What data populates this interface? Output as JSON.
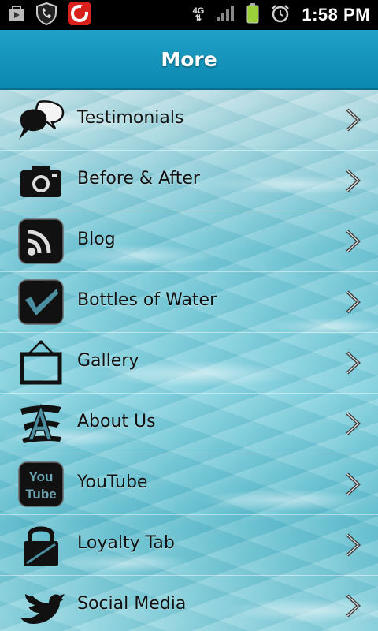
{
  "status_bar": {
    "time": "1:58 PM",
    "network": "4G",
    "icons": [
      "shopping-bag-icon",
      "shield-phone-icon",
      "red-app-icon",
      "signal-icon",
      "battery-icon",
      "alarm-clock-icon"
    ]
  },
  "header": {
    "title": "More"
  },
  "menu": {
    "items": [
      {
        "label": "Testimonials",
        "icon": "speech-bubbles-icon"
      },
      {
        "label": "Before & After",
        "icon": "camera-icon"
      },
      {
        "label": "Blog",
        "icon": "rss-icon"
      },
      {
        "label": "Bottles of Water",
        "icon": "checkmark-icon"
      },
      {
        "label": "Gallery",
        "icon": "picture-frame-icon"
      },
      {
        "label": "About Us",
        "icon": "letter-a-icon"
      },
      {
        "label": "YouTube",
        "icon": "youtube-icon"
      },
      {
        "label": "Loyalty Tab",
        "icon": "padlock-icon"
      },
      {
        "label": "Social Media",
        "icon": "twitter-bird-icon"
      }
    ]
  },
  "colors": {
    "title_bar": "#1fa1c6",
    "status_bar": "#000000",
    "label_text": "#111111"
  }
}
